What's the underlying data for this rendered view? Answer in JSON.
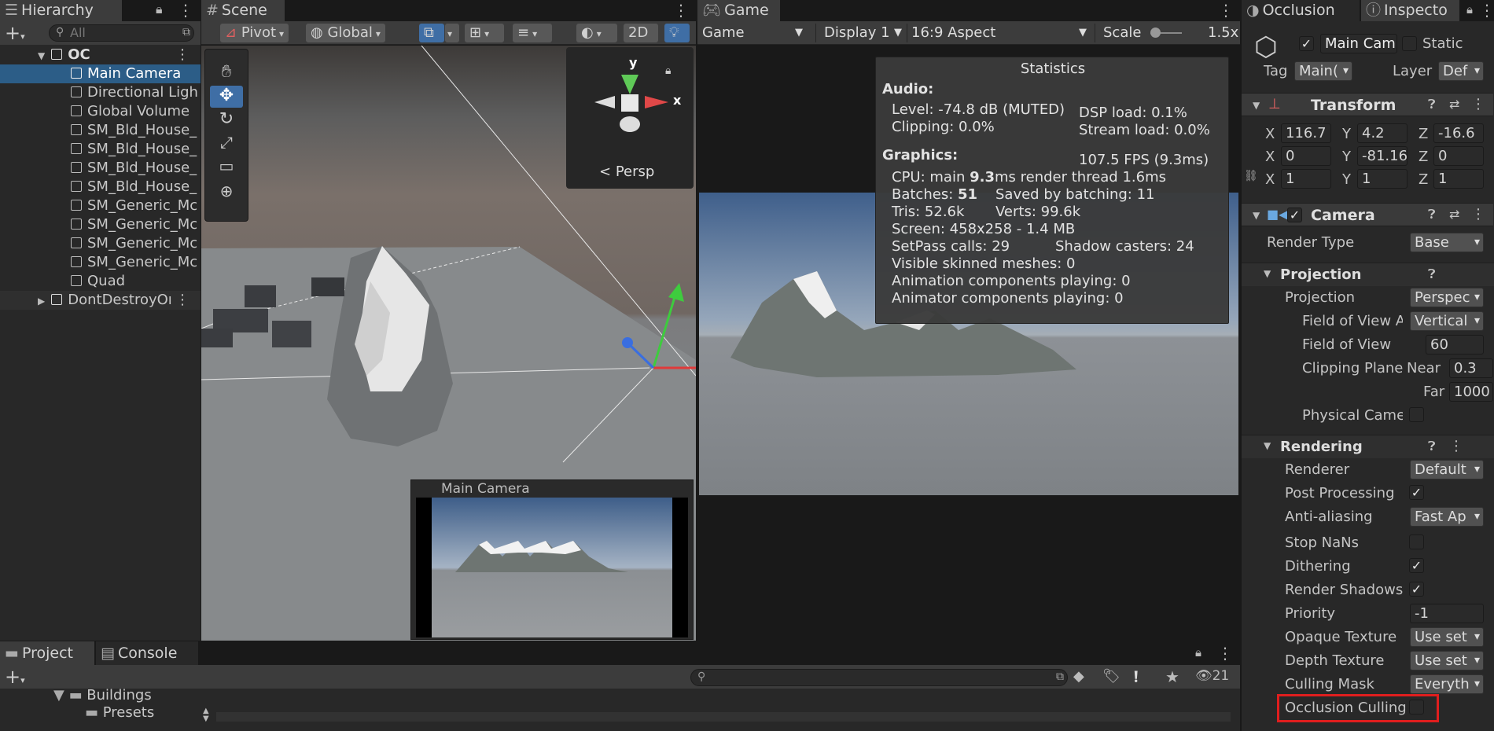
{
  "hierarchy": {
    "tab": "Hierarchy",
    "search_placeholder": "All",
    "scene": "OC",
    "items": [
      "Main Camera",
      "Directional Ligh",
      "Global Volume",
      "SM_Bld_House_",
      "SM_Bld_House_",
      "SM_Bld_House_",
      "SM_Bld_House_",
      "SM_Generic_Mc",
      "SM_Generic_Mc",
      "SM_Generic_Mc",
      "SM_Generic_Mc",
      "Quad"
    ],
    "dontdestroy": "DontDestroyOı"
  },
  "scene": {
    "tab": "Scene",
    "pivot": "Pivot",
    "global": "Global",
    "mode_2d": "2D",
    "gizmo_y": "y",
    "gizmo_x": "x",
    "persp": "Persp",
    "cam_preview_title": "Main Camera"
  },
  "game": {
    "tab": "Game",
    "mode": "Game",
    "display": "Display 1",
    "aspect": "16:9 Aspect",
    "scale_label": "Scale",
    "scale_value": "1.5x"
  },
  "statistics": {
    "title": "Statistics",
    "audio_header": "Audio:",
    "level": "Level: -74.8 dB (MUTED)",
    "clipping": "Clipping: 0.0%",
    "dsp": "DSP load: 0.1%",
    "stream": "Stream load: 0.0%",
    "graphics_header": "Graphics:",
    "fps": "107.5 FPS (9.3ms)",
    "cpu_a": "CPU: main ",
    "cpu_b": "9.3",
    "cpu_c": "ms  render thread 1.6ms",
    "batches_a": "Batches: ",
    "batches_b": "51",
    "saved": "Saved by batching: 11",
    "tris": "Tris: 52.6k",
    "verts": "Verts: 99.6k",
    "screen": "Screen: 458x258 - 1.4 MB",
    "setpass": "SetPass calls: 29",
    "shadow": "Shadow casters: 24",
    "skinned": "Visible skinned meshes: 0",
    "anim": "Animation components playing: 0",
    "animator": "Animator components playing: 0"
  },
  "inspector": {
    "tab_occlusion": "Occlusion",
    "tab_inspector": "Inspecto",
    "object_name": "Main Cam",
    "static_label": "Static",
    "tag_label": "Tag",
    "tag_value": "Main(",
    "layer_label": "Layer",
    "layer_value": "Def",
    "transform": {
      "title": "Transform",
      "pos": {
        "x": "116.7",
        "y": "4.2",
        "z": "-16.6"
      },
      "rot": {
        "x": "0",
        "y": "-81.16",
        "z": "0"
      },
      "scale": {
        "x": "1",
        "y": "1",
        "z": "1"
      }
    },
    "camera": {
      "title": "Camera",
      "render_type_label": "Render Type",
      "render_type": "Base",
      "projection_header": "Projection",
      "projection_label": "Projection",
      "projection_value": "Perspec",
      "fov_axis_label": "Field of View A:",
      "fov_axis_value": "Vertical",
      "fov_label": "Field of View",
      "fov_value": "60",
      "clip_label": "Clipping Plane",
      "near_label": "Near",
      "near_value": "0.3",
      "far_label": "Far",
      "far_value": "1000",
      "physical_label": "Physical Camer",
      "rendering_header": "Rendering",
      "renderer_label": "Renderer",
      "renderer_value": "Default",
      "post_label": "Post Processing",
      "aa_label": "Anti-aliasing",
      "aa_value": "Fast Ap",
      "stopnans_label": "Stop NaNs",
      "dither_label": "Dithering",
      "shadows_label": "Render Shadows",
      "priority_label": "Priority",
      "priority_value": "-1",
      "opaque_label": "Opaque Texture",
      "opaque_value": "Use set",
      "depth_label": "Depth Texture",
      "depth_value": "Use set",
      "culling_label": "Culling Mask",
      "culling_value": "Everyth",
      "occlusion_label": "Occlusion Culling"
    }
  },
  "project": {
    "tab_project": "Project",
    "tab_console": "Console",
    "folder1": "Buildings",
    "folder2": "Presets",
    "count": "21"
  },
  "colors": {
    "selection": "#2c5d87",
    "accent": "#3f6ea5",
    "highlight_box": "#e01e1e"
  }
}
